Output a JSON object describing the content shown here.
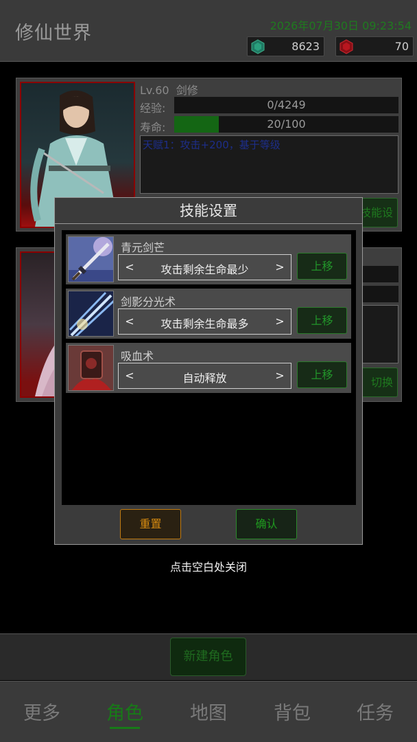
{
  "header": {
    "title": "修仙世界",
    "datetime": "2026年07月30日 09:23:54",
    "currency_green": "8623",
    "currency_red": "70"
  },
  "character1": {
    "level": "Lv.60",
    "class": "剑修",
    "exp_label": "经验:",
    "exp_value": "0/4249",
    "exp_fraction": 0,
    "life_label": "寿命:",
    "life_value": "20/100",
    "life_fraction": 0.2,
    "talent": "天赋1：攻击+200，基于等级",
    "settings_button": "技能设置"
  },
  "character2": {
    "switch_button": "切换"
  },
  "modal": {
    "title": "技能设置",
    "skills": [
      {
        "name": "青元剑芒",
        "target": "攻击剩余生命最少",
        "up_label": "上移",
        "prev": "<",
        "next": ">"
      },
      {
        "name": "剑影分光术",
        "target": "攻击剩余生命最多",
        "up_label": "上移",
        "prev": "<",
        "next": ">"
      },
      {
        "name": "吸血术",
        "target": "自动释放",
        "up_label": "上移",
        "prev": "<",
        "next": ">"
      }
    ],
    "reset_label": "重置",
    "confirm_label": "确认",
    "close_hint": "点击空白处关闭"
  },
  "create_button": "新建角色",
  "tabs": [
    {
      "label": "更多",
      "active": false
    },
    {
      "label": "角色",
      "active": true
    },
    {
      "label": "地图",
      "active": false
    },
    {
      "label": "背包",
      "active": false
    },
    {
      "label": "任务",
      "active": false
    }
  ],
  "colors": {
    "accent_green": "#1f7a1f",
    "reset_orange": "#d68a10",
    "portrait_red": "#8b0000"
  }
}
